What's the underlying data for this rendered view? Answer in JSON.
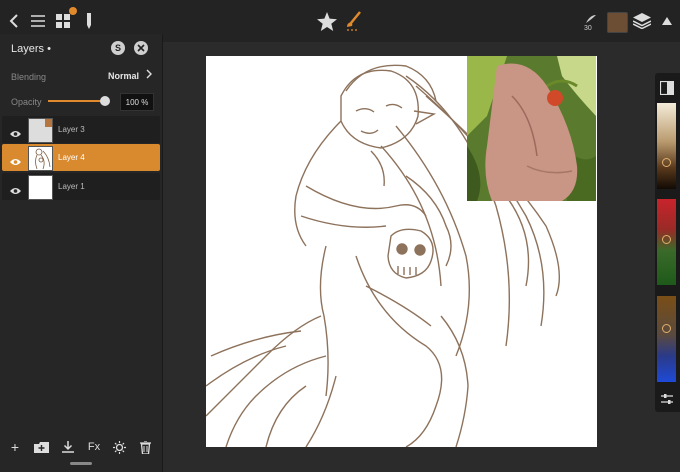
{
  "toolbar": {
    "brush_size": "30",
    "color_hex": "#6b4e34",
    "accent": "#e08a2b"
  },
  "layers_panel": {
    "title": "Layers •",
    "icons": [
      "s-circle-icon",
      "close-icon"
    ],
    "s_label": "S",
    "blending_label": "Blending",
    "blending_value": "Normal",
    "opacity_label": "Opacity",
    "opacity_value": "100 %",
    "opacity_level": 1.0,
    "layers": [
      {
        "name": "Layer 3",
        "selected": false,
        "visible": true
      },
      {
        "name": "Layer 4",
        "selected": true,
        "visible": true
      },
      {
        "name": "Layer 1",
        "selected": false,
        "visible": true
      }
    ],
    "fx_label": "Fx"
  }
}
